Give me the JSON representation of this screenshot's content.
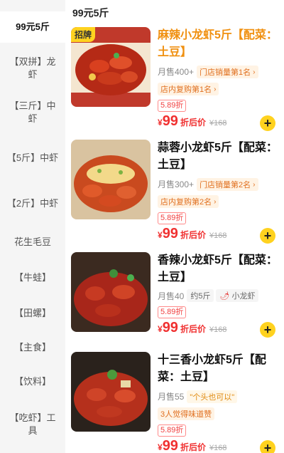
{
  "sidebar": {
    "items": [
      {
        "label": "99元5斤"
      },
      {
        "label": "【双拼】龙虾"
      },
      {
        "label": "【三斤】中虾"
      },
      {
        "label": "【5斤】中虾"
      },
      {
        "label": "【2斤】中虾"
      },
      {
        "label": "花生毛豆"
      },
      {
        "label": "【牛蛙】"
      },
      {
        "label": "【田螺】"
      },
      {
        "label": "【主食】"
      },
      {
        "label": "【饮料】"
      },
      {
        "label": "【吃虾】工具"
      }
    ]
  },
  "main": {
    "section_title": "99元5斤",
    "products": [
      {
        "badge": "招牌",
        "name": "麻辣小龙虾5斤【配菜：土豆】",
        "sales": "月售400+",
        "tags": [
          "门店销量第1名",
          "店内复购第1名"
        ],
        "discount": "5.89折",
        "price_symbol": "¥",
        "price": "99",
        "price_note": "折后价",
        "original_price": "¥168"
      },
      {
        "name": "蒜蓉小龙虾5斤【配菜：土豆】",
        "sales": "月售300+",
        "tags": [
          "门店销量第2名",
          "店内复购第2名"
        ],
        "discount": "5.89折",
        "price_symbol": "¥",
        "price": "99",
        "price_note": "折后价",
        "original_price": "¥168"
      },
      {
        "name": "香辣小龙虾5斤【配菜：土豆】",
        "sales": "月售40",
        "weight": "约5斤",
        "spice_tag": "小龙虾",
        "discount": "5.89折",
        "price_symbol": "¥",
        "price": "99",
        "price_note": "折后价",
        "original_price": "¥168"
      },
      {
        "name": "十三香小龙虾5斤【配菜：土豆】",
        "sales": "月售55",
        "quote": "\"个头也可以\"",
        "praise": "3人觉得味道赞",
        "discount": "5.89折",
        "price_symbol": "¥",
        "price": "99",
        "price_note": "折后价",
        "original_price": "¥168"
      }
    ]
  },
  "colors": {
    "accent_yellow": "#ffd21f",
    "price_red": "#f03030",
    "highlight_orange": "#f09010",
    "sidebar_bg": "#f5f5f5"
  }
}
